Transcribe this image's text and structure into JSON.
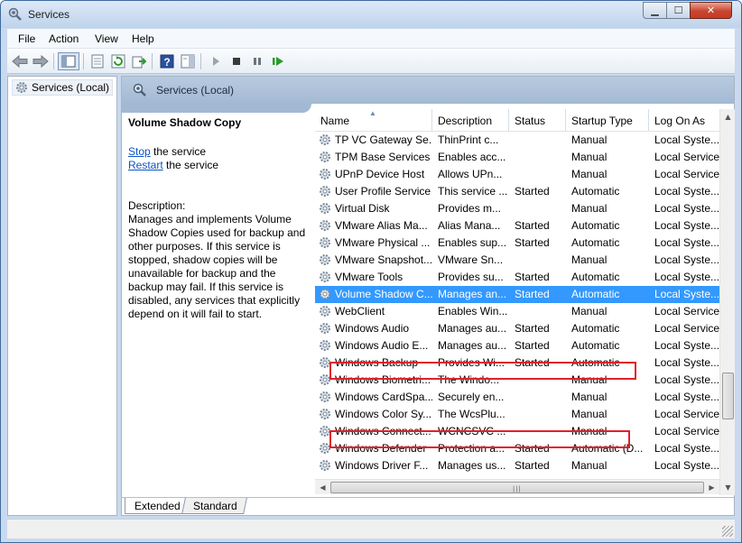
{
  "window": {
    "title": "Services"
  },
  "menu": [
    "File",
    "Action",
    "View",
    "Help"
  ],
  "toolbar_icons": [
    "back-icon",
    "forward-icon",
    "show-tree-icon",
    "properties-icon",
    "refresh-icon",
    "export-icon",
    "help-icon",
    "show-hide-action-pane-icon",
    "start-service-icon",
    "stop-service-icon",
    "pause-service-icon",
    "restart-service-icon"
  ],
  "tree": {
    "label": "Services (Local)"
  },
  "header": {
    "label": "Services (Local)"
  },
  "details": {
    "title": "Volume Shadow Copy",
    "stop_link": "Stop",
    "stop_text": " the service",
    "restart_link": "Restart",
    "restart_text": " the service",
    "desc_label": "Description:",
    "desc_text": "Manages and implements Volume Shadow Copies used for backup and other purposes. If this service is stopped, shadow copies will be unavailable for backup and the backup may fail. If this service is disabled, any services that explicitly depend on it will fail to start."
  },
  "columns": [
    "Name",
    "Description",
    "Status",
    "Startup Type",
    "Log On As"
  ],
  "rows": [
    {
      "name": "TP VC Gateway Se...",
      "desc": "ThinPrint c...",
      "status": "",
      "startup": "Manual",
      "logon": "Local Syste..."
    },
    {
      "name": "TPM Base Services",
      "desc": "Enables acc...",
      "status": "",
      "startup": "Manual",
      "logon": "Local Service"
    },
    {
      "name": "UPnP Device Host",
      "desc": "Allows UPn...",
      "status": "",
      "startup": "Manual",
      "logon": "Local Service"
    },
    {
      "name": "User Profile Service",
      "desc": "This service ...",
      "status": "Started",
      "startup": "Automatic",
      "logon": "Local Syste..."
    },
    {
      "name": "Virtual Disk",
      "desc": "Provides m...",
      "status": "",
      "startup": "Manual",
      "logon": "Local Syste..."
    },
    {
      "name": "VMware Alias Ma...",
      "desc": "Alias Mana...",
      "status": "Started",
      "startup": "Automatic",
      "logon": "Local Syste..."
    },
    {
      "name": "VMware Physical ...",
      "desc": "Enables sup...",
      "status": "Started",
      "startup": "Automatic",
      "logon": "Local Syste..."
    },
    {
      "name": "VMware Snapshot...",
      "desc": "VMware Sn...",
      "status": "",
      "startup": "Manual",
      "logon": "Local Syste..."
    },
    {
      "name": "VMware Tools",
      "desc": "Provides su...",
      "status": "Started",
      "startup": "Automatic",
      "logon": "Local Syste..."
    },
    {
      "name": "Volume Shadow C...",
      "desc": "Manages an...",
      "status": "Started",
      "startup": "Automatic",
      "logon": "Local Syste...",
      "selected": true
    },
    {
      "name": "WebClient",
      "desc": "Enables Win...",
      "status": "",
      "startup": "Manual",
      "logon": "Local Service"
    },
    {
      "name": "Windows Audio",
      "desc": "Manages au...",
      "status": "Started",
      "startup": "Automatic",
      "logon": "Local Service"
    },
    {
      "name": "Windows Audio E...",
      "desc": "Manages au...",
      "status": "Started",
      "startup": "Automatic",
      "logon": "Local Syste..."
    },
    {
      "name": "Windows Backup",
      "desc": "Provides Wi...",
      "status": "Started",
      "startup": "Automatic",
      "logon": "Local Syste..."
    },
    {
      "name": "Windows Biometri...",
      "desc": "The Windo...",
      "status": "",
      "startup": "Manual",
      "logon": "Local Syste..."
    },
    {
      "name": "Windows CardSpa...",
      "desc": "Securely en...",
      "status": "",
      "startup": "Manual",
      "logon": "Local Syste..."
    },
    {
      "name": "Windows Color Sy...",
      "desc": "The WcsPlu...",
      "status": "",
      "startup": "Manual",
      "logon": "Local Service"
    },
    {
      "name": "Windows Connect...",
      "desc": "WCNCSVC ...",
      "status": "",
      "startup": "Manual",
      "logon": "Local Service"
    },
    {
      "name": "Windows Defender",
      "desc": "Protection a...",
      "status": "Started",
      "startup": "Automatic (D...",
      "logon": "Local Syste..."
    },
    {
      "name": "Windows Driver F...",
      "desc": "Manages us...",
      "status": "Started",
      "startup": "Manual",
      "logon": "Local Syste..."
    }
  ],
  "tabs": [
    "Extended",
    "Standard"
  ],
  "colors": {
    "selection": "#3399ff",
    "highlight_box": "#e0202a",
    "link": "#0b55c4"
  }
}
